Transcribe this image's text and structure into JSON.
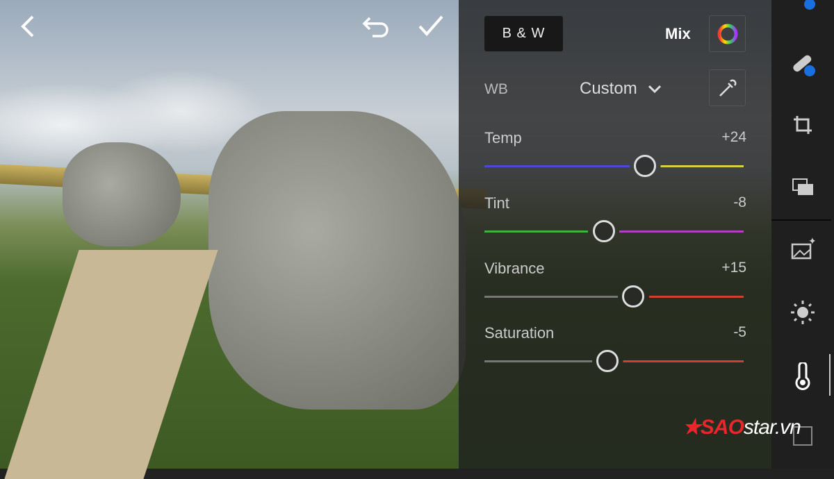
{
  "header": {
    "back_icon": "chevron-left",
    "undo_icon": "undo",
    "confirm_icon": "checkmark"
  },
  "panel": {
    "bw_label": "B & W",
    "mix_label": "Mix",
    "mix_icon": "color-wheel",
    "wb_label": "WB",
    "wb_value": "Custom",
    "eyedropper_icon": "eyedropper",
    "sliders": [
      {
        "label": "Temp",
        "value": "+24",
        "level": 24,
        "colors": [
          "#4a4ad0",
          "#d8d040"
        ]
      },
      {
        "label": "Tint",
        "value": "-8",
        "level": -8,
        "colors": [
          "#40b040",
          "#b040c0"
        ]
      },
      {
        "label": "Vibrance",
        "value": "+15",
        "level": 15,
        "colors": [
          "#777777",
          "#d04030"
        ]
      },
      {
        "label": "Saturation",
        "value": "-5",
        "level": -5,
        "colors": [
          "#777777",
          "#d04030"
        ]
      }
    ]
  },
  "toolbar": [
    "selective-edit",
    "healing",
    "crop",
    "presets",
    "auto",
    "light",
    "color",
    "effects"
  ],
  "watermark": {
    "brand": "SAO",
    "rest": "star.vn"
  }
}
